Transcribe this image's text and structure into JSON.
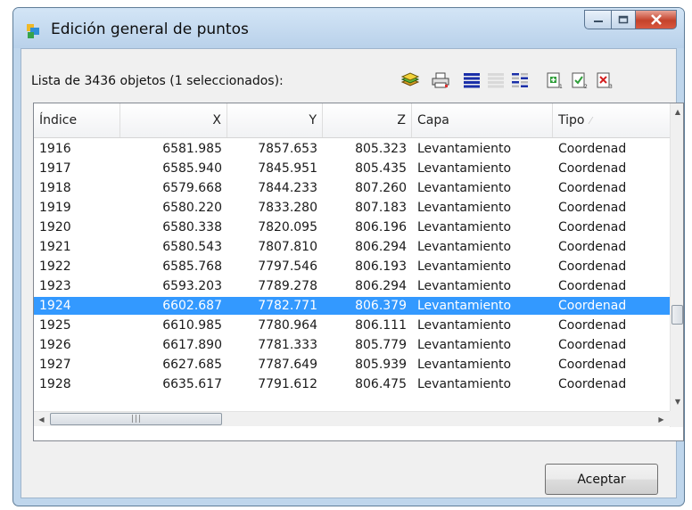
{
  "window": {
    "title": "Edición general de puntos"
  },
  "list_caption": "Lista de 3436 objetos (1 seleccionados):",
  "toolbar": {
    "icons": [
      "layers-icon",
      "print-icon",
      "select-all-icon",
      "select-none-icon",
      "invert-selection-icon",
      "add-icon",
      "edit-icon",
      "delete-icon"
    ]
  },
  "table": {
    "columns": [
      "Índice",
      "X",
      "Y",
      "Z",
      "Capa",
      "Tipo"
    ],
    "selected_index": 8,
    "rows": [
      [
        "1916",
        "6581.985",
        "7857.653",
        "805.323",
        "Levantamiento",
        "Coordenad"
      ],
      [
        "1917",
        "6585.940",
        "7845.951",
        "805.435",
        "Levantamiento",
        "Coordenad"
      ],
      [
        "1918",
        "6579.668",
        "7844.233",
        "807.260",
        "Levantamiento",
        "Coordenad"
      ],
      [
        "1919",
        "6580.220",
        "7833.280",
        "807.183",
        "Levantamiento",
        "Coordenad"
      ],
      [
        "1920",
        "6580.338",
        "7820.095",
        "806.196",
        "Levantamiento",
        "Coordenad"
      ],
      [
        "1921",
        "6580.543",
        "7807.810",
        "806.294",
        "Levantamiento",
        "Coordenad"
      ],
      [
        "1922",
        "6585.768",
        "7797.546",
        "806.193",
        "Levantamiento",
        "Coordenad"
      ],
      [
        "1923",
        "6593.203",
        "7789.278",
        "806.294",
        "Levantamiento",
        "Coordenad"
      ],
      [
        "1924",
        "6602.687",
        "7782.771",
        "806.379",
        "Levantamiento",
        "Coordenad"
      ],
      [
        "1925",
        "6610.985",
        "7780.964",
        "806.111",
        "Levantamiento",
        "Coordenad"
      ],
      [
        "1926",
        "6617.890",
        "7781.333",
        "805.779",
        "Levantamiento",
        "Coordenad"
      ],
      [
        "1927",
        "6627.685",
        "7787.649",
        "805.939",
        "Levantamiento",
        "Coordenad"
      ],
      [
        "1928",
        "6635.617",
        "7791.612",
        "806.475",
        "Levantamiento",
        "Coordenad"
      ]
    ]
  },
  "buttons": {
    "accept_label": "Aceptar"
  },
  "colors": {
    "selection": "#3399ff",
    "window_frame": "#bfd6ec"
  }
}
